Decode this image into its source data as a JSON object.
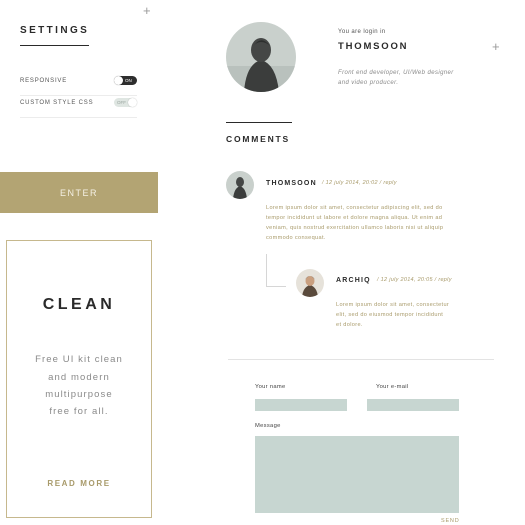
{
  "settings": {
    "title": "SETTINGS",
    "plus": "+",
    "rows": [
      {
        "label": "RESPONSIVE",
        "state": "on",
        "toggle_text": "ON"
      },
      {
        "label": "CUSTOM STYLE CSS",
        "state": "off",
        "toggle_text": "OFF"
      }
    ]
  },
  "enter_button": {
    "label": "ENTER"
  },
  "clean_card": {
    "heading": "CLEAN",
    "description": [
      "Free UI kit clean",
      "and modern",
      "multipurpose",
      "free for all."
    ],
    "read_more": "READ MORE"
  },
  "profile": {
    "subtitle": "You are login in",
    "name": "THOMSOON",
    "plus": "+",
    "bio": [
      "Front end developer, UI/Web designer",
      "and video producer."
    ]
  },
  "comments": {
    "title": "COMMENTS",
    "items": [
      {
        "name": "THOMSOON",
        "meta": "/ 12 july 2014, 20:02 / reply",
        "body": [
          "Lorem ipsum dolor sit amet, consectetur adipiscing elit, sed do",
          "tempor incididunt ut labore et dolore magna aliqua. Ut enim ad",
          "veniam, quis nostrud exercitation ullamco laboris nisi ut aliquip",
          "commodo consequat."
        ]
      },
      {
        "name": "ARCHIQ",
        "meta": "/ 12 july 2014, 20:05 / reply",
        "body": [
          "Lorem ipsum dolor sit amet, consectetur",
          "elit, sed do eiusmod tempor incididunt",
          "et dolore."
        ]
      }
    ]
  },
  "form": {
    "name_label": "Your name",
    "name_value": "",
    "email_label": "Your e-mail",
    "email_value": "",
    "message_label": "Message",
    "message_value": "",
    "send_label": "SEND"
  },
  "colors": {
    "accent_gold": "#b3a473",
    "input_fill": "#c7d6d1",
    "toggle_on": "#2e2e2e"
  }
}
